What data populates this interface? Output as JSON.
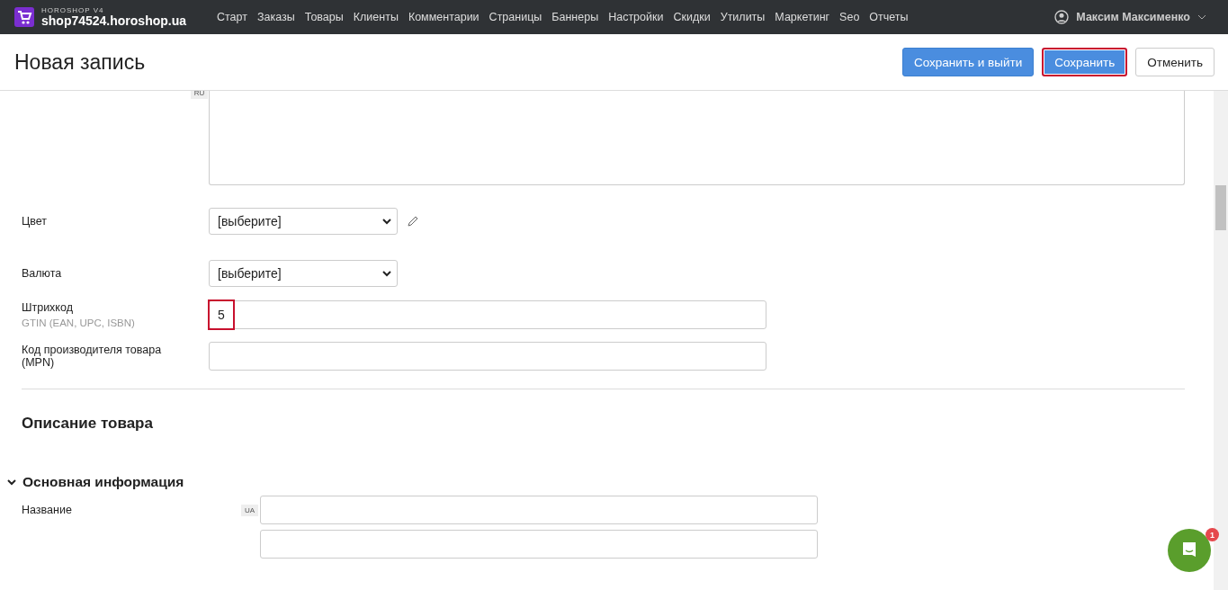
{
  "brand": {
    "subtitle": "HOROSHOP V4",
    "domain": "shop74524.horoshop.ua"
  },
  "nav": [
    "Старт",
    "Заказы",
    "Товары",
    "Клиенты",
    "Комментарии",
    "Страницы",
    "Баннеры",
    "Настройки",
    "Скидки",
    "Утилиты",
    "Маркетинг",
    "Seo",
    "Отчеты"
  ],
  "user": {
    "name": "Максим Максименко"
  },
  "page_title": "Новая запись",
  "actions": [
    {
      "label": "Сохранить и выйти",
      "kind": "primary",
      "highlighted": false
    },
    {
      "label": "Сохранить",
      "kind": "primary",
      "highlighted": true
    },
    {
      "label": "Отменить",
      "kind": "secondary",
      "highlighted": false
    }
  ],
  "textarea": {
    "lang": "RU"
  },
  "fields": [
    {
      "label": "Цвет",
      "kind": "select",
      "value": "[выберите]",
      "editable": true
    },
    {
      "label": "Валюта",
      "kind": "select",
      "value": "[выберите]",
      "editable": false
    },
    {
      "label": "Штрихкод",
      "hint": "GTIN (EAN, UPC, ISBN)",
      "kind": "text",
      "value": "5",
      "highlighted": true
    },
    {
      "label": "Код производителя товара (MPN)",
      "kind": "text",
      "highlighted": false
    }
  ],
  "section_title": "Описание товара",
  "group": {
    "title": "Основная информация",
    "expanded": true
  },
  "name_field": {
    "label": "Название",
    "lang": "UA"
  },
  "chat": {
    "badge": "1"
  }
}
